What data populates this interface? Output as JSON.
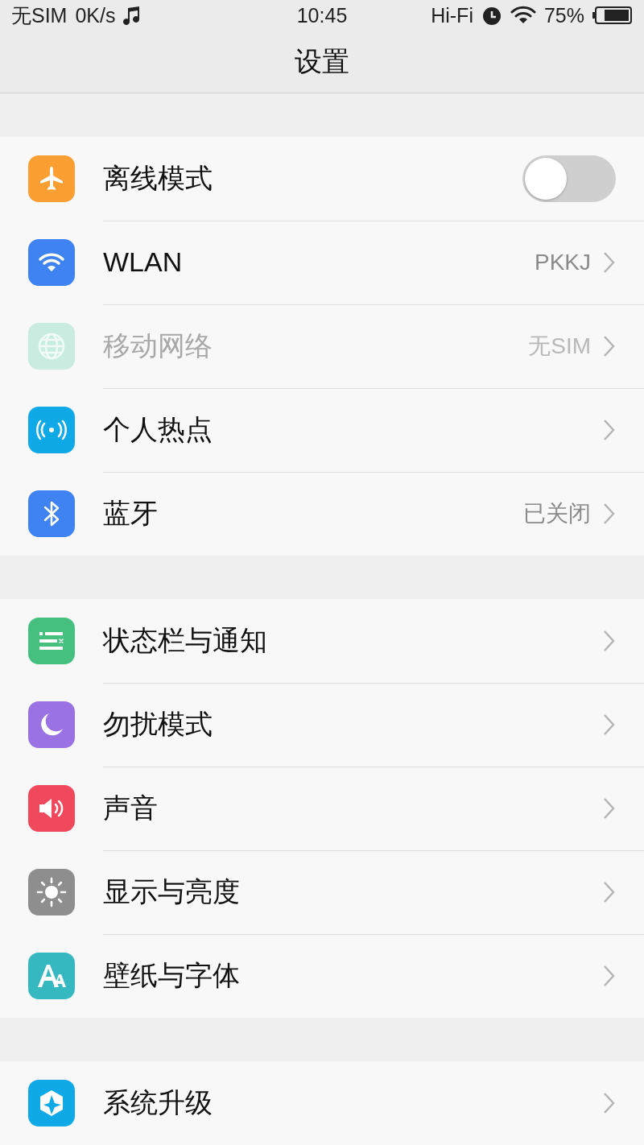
{
  "status_bar": {
    "carrier": "无SIM",
    "speed": "0K/s",
    "time": "10:45",
    "audio": "Hi-Fi",
    "battery": "75%"
  },
  "header": {
    "title": "设置"
  },
  "groups": [
    {
      "rows": [
        {
          "kind": "toggle",
          "color": "#fb9f33",
          "label": "离线模式",
          "on": false,
          "disabled": false
        },
        {
          "kind": "link",
          "color": "#3f82f1",
          "label": "WLAN",
          "value": "PKKJ",
          "disabled": false
        },
        {
          "kind": "link",
          "color": "#c8ece0",
          "label": "移动网络",
          "value": "无SIM",
          "disabled": true
        },
        {
          "kind": "link",
          "color": "#10a9e8",
          "label": "个人热点",
          "disabled": false
        },
        {
          "kind": "link",
          "color": "#3f82f1",
          "label": "蓝牙",
          "value": "已关闭",
          "disabled": false
        }
      ]
    },
    {
      "rows": [
        {
          "kind": "link",
          "color": "#45c07e",
          "label": "状态栏与通知",
          "disabled": false
        },
        {
          "kind": "link",
          "color": "#9a72e3",
          "label": "勿扰模式",
          "disabled": false
        },
        {
          "kind": "link",
          "color": "#f0485c",
          "label": "声音",
          "disabled": false
        },
        {
          "kind": "link",
          "color": "#8e8e8e",
          "label": "显示与亮度",
          "disabled": false
        },
        {
          "kind": "link",
          "color": "#35b8c0",
          "label": "壁纸与字体",
          "disabled": false
        }
      ]
    },
    {
      "rows": [
        {
          "kind": "link",
          "color": "#10a9e8",
          "label": "系统升级",
          "disabled": false
        }
      ]
    }
  ]
}
